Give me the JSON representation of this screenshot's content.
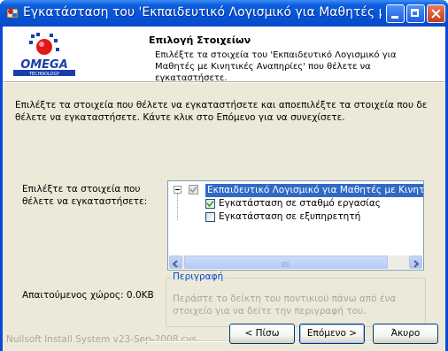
{
  "window": {
    "title": "Εγκατάσταση του 'Εκπαιδευτικό Λογισμικό για Μαθητές με Κινη..."
  },
  "header": {
    "logo_text": "OMEGA",
    "logo_subtext": "TECHNOLOGY",
    "title": "Επιλογή Στοιχείων",
    "subtitle": "Επιλέξτε τα στοιχεία του 'Εκπαιδευτικό Λογισμικό για Μαθητές με Κινητικές Αναπηρίες' που θέλετε να εγκαταστήσετε."
  },
  "intro_text": "Επιλέξτε τα στοιχεία που θέλετε να εγκαταστήσετε και αποεπιλέξτε τα στοιχεία που δε θέλετε να εγκαταστήσετε. Κάντε κλικ στο Επόμενο για να συνεχίσετε.",
  "select_label": "Επιλέξτε τα στοιχεία που θέλετε να εγκαταστήσετε:",
  "tree": {
    "root": "Εκπαιδευτικό Λογισμικό για Μαθητές με Κινητικές Αν",
    "items": [
      {
        "label": "Εγκατάσταση σε σταθμό εργασίας",
        "checked": true
      },
      {
        "label": "Εγκατάσταση σε εξυπηρετητή",
        "checked": false
      }
    ]
  },
  "space_required": "Απαιτούμενος χώρος: 0.0KB",
  "description": {
    "legend": "Περιγραφή",
    "text": "Περάστε το δείκτη του ποντικιού πάνω από ένα στοιχείο για να δείτε την περιγραφή του."
  },
  "branding": "Nullsoft Install System v23-Sep-2008.cvs",
  "buttons": {
    "back": "< Πίσω",
    "next": "Επόμενο >",
    "cancel": "Άκυρο"
  },
  "colors": {
    "titlebar": "#0553d8",
    "selection": "#316ac5",
    "dialog_bg": "#ece9d8",
    "legend_text": "#0046d5"
  }
}
